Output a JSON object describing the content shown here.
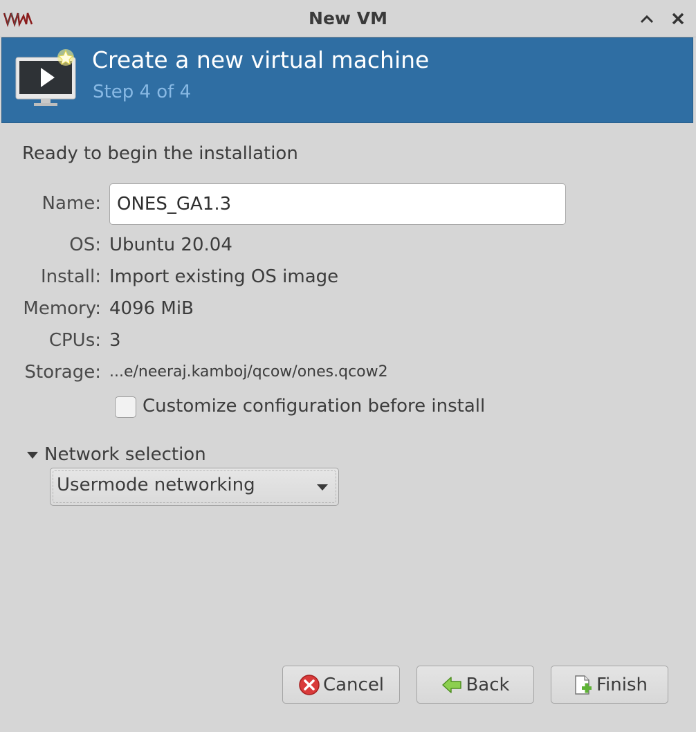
{
  "window": {
    "title": "New VM"
  },
  "banner": {
    "heading": "Create a new virtual machine",
    "step": "Step 4 of 4"
  },
  "summary": {
    "intro": "Ready to begin the installation",
    "name_label": "Name:",
    "name_value": "ONES_GA1.3",
    "os_label": "OS:",
    "os_value": "Ubuntu 20.04",
    "install_label": "Install:",
    "install_value": "Import existing OS image",
    "memory_label": "Memory:",
    "memory_value": "4096 MiB",
    "cpus_label": "CPUs:",
    "cpus_value": "3",
    "storage_label": "Storage:",
    "storage_value": "...e/neeraj.kamboj/qcow/ones.qcow2"
  },
  "customize": {
    "label": "Customize configuration before install",
    "checked": false
  },
  "network": {
    "expander_label": "Network selection",
    "selected": "Usermode networking"
  },
  "buttons": {
    "cancel": "Cancel",
    "back": "Back",
    "finish": "Finish"
  },
  "colors": {
    "banner_bg": "#2f6ea3",
    "step_text": "#88b9e4",
    "window_bg": "#d6d6d6"
  }
}
